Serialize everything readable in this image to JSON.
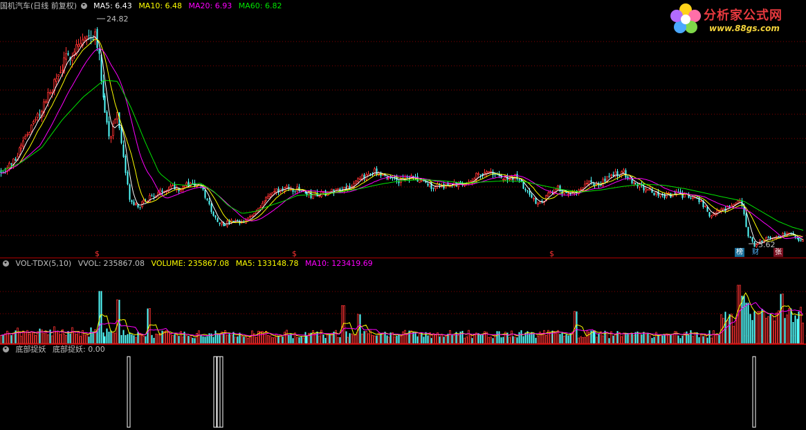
{
  "colors": {
    "bg": "#000000",
    "grid": "#8b0000",
    "up": "#ff3232",
    "down": "#54ffff",
    "ma5": "#ffffff",
    "ma10": "#ffff00",
    "ma20": "#ff00ff",
    "ma60": "#00e600",
    "signal": "#ffffff",
    "text": "#c0c0c0"
  },
  "price_panel": {
    "title": "国机汽车(日线 前复权)",
    "ma5_label": "MA5: 6.43",
    "ma10_label": "MA10: 6.48",
    "ma20_label": "MA20: 6.93",
    "ma60_label": "MA60: 6.82",
    "high_label": "24.82",
    "low_label": "5.62",
    "menu_icon": "dropdown-circle-icon"
  },
  "volume_panel": {
    "name": "VOL-TDX(5,10)",
    "vvol_label": "VVOL: 235867.08",
    "volume_label": "VOLUME: 235867.08",
    "ma5_label": "MA5: 133148.78",
    "ma10_label": "MA10: 123419.69",
    "menu_icon": "dropdown-circle-icon"
  },
  "indicator_panel": {
    "name": "底部捉妖",
    "value_label": "底部捉妖: 0.00",
    "menu_icon": "dropdown-circle-icon"
  },
  "markers": {
    "dollar": "$",
    "badge_bang": "榜",
    "badge_cai": "财",
    "badge_zhang": "张"
  },
  "watermark": {
    "title": "分析家公式网",
    "url": "www.88gs.com",
    "logo_icon": "flower-logo-icon"
  },
  "chart_data": [
    {
      "type": "candlestick",
      "title": "国机汽车(日线 前复权)",
      "series": [
        {
          "name": "MA5",
          "last": 6.43
        },
        {
          "name": "MA10",
          "last": 6.48
        },
        {
          "name": "MA20",
          "last": 6.93
        },
        {
          "name": "MA60",
          "last": 6.82
        }
      ],
      "annotations": [
        {
          "text": "24.82",
          "value": 24.82,
          "kind": "max"
        },
        {
          "text": "5.62",
          "value": 5.62,
          "kind": "min"
        }
      ],
      "ylim": [
        4.8,
        26.5
      ],
      "price_path": [
        [
          0,
          12.4
        ],
        [
          10,
          12.8
        ],
        [
          20,
          13.4
        ],
        [
          35,
          15.5
        ],
        [
          50,
          16.8
        ],
        [
          65,
          18.6
        ],
        [
          80,
          20.5
        ],
        [
          95,
          22.3
        ],
        [
          110,
          23.6
        ],
        [
          125,
          24.2
        ],
        [
          138,
          24.82
        ],
        [
          148,
          19.5
        ],
        [
          158,
          15.2
        ],
        [
          168,
          17.8
        ],
        [
          178,
          13.4
        ],
        [
          188,
          9.6
        ],
        [
          200,
          9.3
        ],
        [
          215,
          10.1
        ],
        [
          230,
          10.5
        ],
        [
          245,
          11.2
        ],
        [
          260,
          10.9
        ],
        [
          275,
          11.4
        ],
        [
          290,
          11.0
        ],
        [
          300,
          9.7
        ],
        [
          310,
          8.3
        ],
        [
          322,
          7.7
        ],
        [
          335,
          8.0
        ],
        [
          350,
          7.8
        ],
        [
          365,
          8.6
        ],
        [
          380,
          9.8
        ],
        [
          395,
          10.6
        ],
        [
          410,
          10.9
        ],
        [
          430,
          10.8
        ],
        [
          450,
          10.3
        ],
        [
          470,
          10.5
        ],
        [
          490,
          10.9
        ],
        [
          510,
          11.2
        ],
        [
          525,
          11.9
        ],
        [
          537,
          12.6
        ],
        [
          550,
          11.9
        ],
        [
          565,
          11.9
        ],
        [
          580,
          11.6
        ],
        [
          595,
          11.9
        ],
        [
          610,
          11.5
        ],
        [
          625,
          11.1
        ],
        [
          640,
          11.2
        ],
        [
          660,
          11.3
        ],
        [
          680,
          11.7
        ],
        [
          700,
          12.4
        ],
        [
          715,
          12.1
        ],
        [
          730,
          11.8
        ],
        [
          745,
          11.9
        ],
        [
          760,
          10.8
        ],
        [
          775,
          9.6
        ],
        [
          790,
          10.2
        ],
        [
          805,
          11.1
        ],
        [
          820,
          10.2
        ],
        [
          835,
          10.9
        ],
        [
          850,
          11.5
        ],
        [
          865,
          11.2
        ],
        [
          880,
          11.9
        ],
        [
          900,
          12.4
        ],
        [
          915,
          11.5
        ],
        [
          930,
          11.0
        ],
        [
          945,
          10.5
        ],
        [
          960,
          10.3
        ],
        [
          980,
          10.4
        ],
        [
          1000,
          10.2
        ],
        [
          1015,
          9.6
        ],
        [
          1025,
          8.4
        ],
        [
          1040,
          9.0
        ],
        [
          1055,
          9.2
        ],
        [
          1065,
          9.8
        ],
        [
          1072,
          9.6
        ],
        [
          1080,
          6.8
        ],
        [
          1090,
          5.8
        ],
        [
          1100,
          6.3
        ],
        [
          1115,
          6.6
        ],
        [
          1130,
          6.8
        ],
        [
          1140,
          7.1
        ],
        [
          1150,
          6.5
        ],
        [
          1162,
          6.3
        ]
      ],
      "ma60_path": [
        [
          0,
          12.4
        ],
        [
          30,
          13.2
        ],
        [
          60,
          14.5
        ],
        [
          90,
          17.0
        ],
        [
          120,
          19.0
        ],
        [
          150,
          20.5
        ],
        [
          170,
          20.4
        ],
        [
          190,
          18.0
        ],
        [
          210,
          15.0
        ],
        [
          230,
          12.3
        ],
        [
          250,
          11.3
        ],
        [
          270,
          11.2
        ],
        [
          290,
          11.4
        ],
        [
          310,
          10.6
        ],
        [
          330,
          9.4
        ],
        [
          350,
          8.7
        ],
        [
          370,
          8.9
        ],
        [
          390,
          9.4
        ],
        [
          410,
          9.8
        ],
        [
          430,
          10.3
        ],
        [
          460,
          10.4
        ],
        [
          490,
          10.6
        ],
        [
          520,
          10.9
        ],
        [
          550,
          11.3
        ],
        [
          580,
          11.6
        ],
        [
          610,
          11.7
        ],
        [
          640,
          11.6
        ],
        [
          670,
          11.4
        ],
        [
          700,
          11.5
        ],
        [
          730,
          11.6
        ],
        [
          760,
          11.5
        ],
        [
          790,
          11.1
        ],
        [
          815,
          10.8
        ],
        [
          840,
          10.6
        ],
        [
          870,
          10.8
        ],
        [
          900,
          11.1
        ],
        [
          930,
          11.3
        ],
        [
          960,
          11.2
        ],
        [
          990,
          10.9
        ],
        [
          1020,
          10.5
        ],
        [
          1050,
          10.1
        ],
        [
          1075,
          9.8
        ],
        [
          1100,
          8.9
        ],
        [
          1125,
          8.0
        ],
        [
          1145,
          7.5
        ],
        [
          1162,
          7.2
        ]
      ]
    },
    {
      "type": "bar",
      "title": "VOL-TDX(5,10)",
      "series": [
        {
          "name": "VVOL",
          "last": 235867.08
        },
        {
          "name": "VOLUME",
          "last": 235867.08
        },
        {
          "name": "MA5",
          "last": 133148.78
        },
        {
          "name": "MA10",
          "last": 123419.69
        }
      ],
      "ylim": [
        0,
        420000
      ]
    },
    {
      "type": "bar",
      "title": "底部捉妖",
      "series": [
        {
          "name": "底部捉妖",
          "last": 0.0
        }
      ],
      "signal_bars": [
        186,
        311,
        316,
        320,
        1090
      ],
      "ylim": [
        0,
        1
      ]
    }
  ]
}
